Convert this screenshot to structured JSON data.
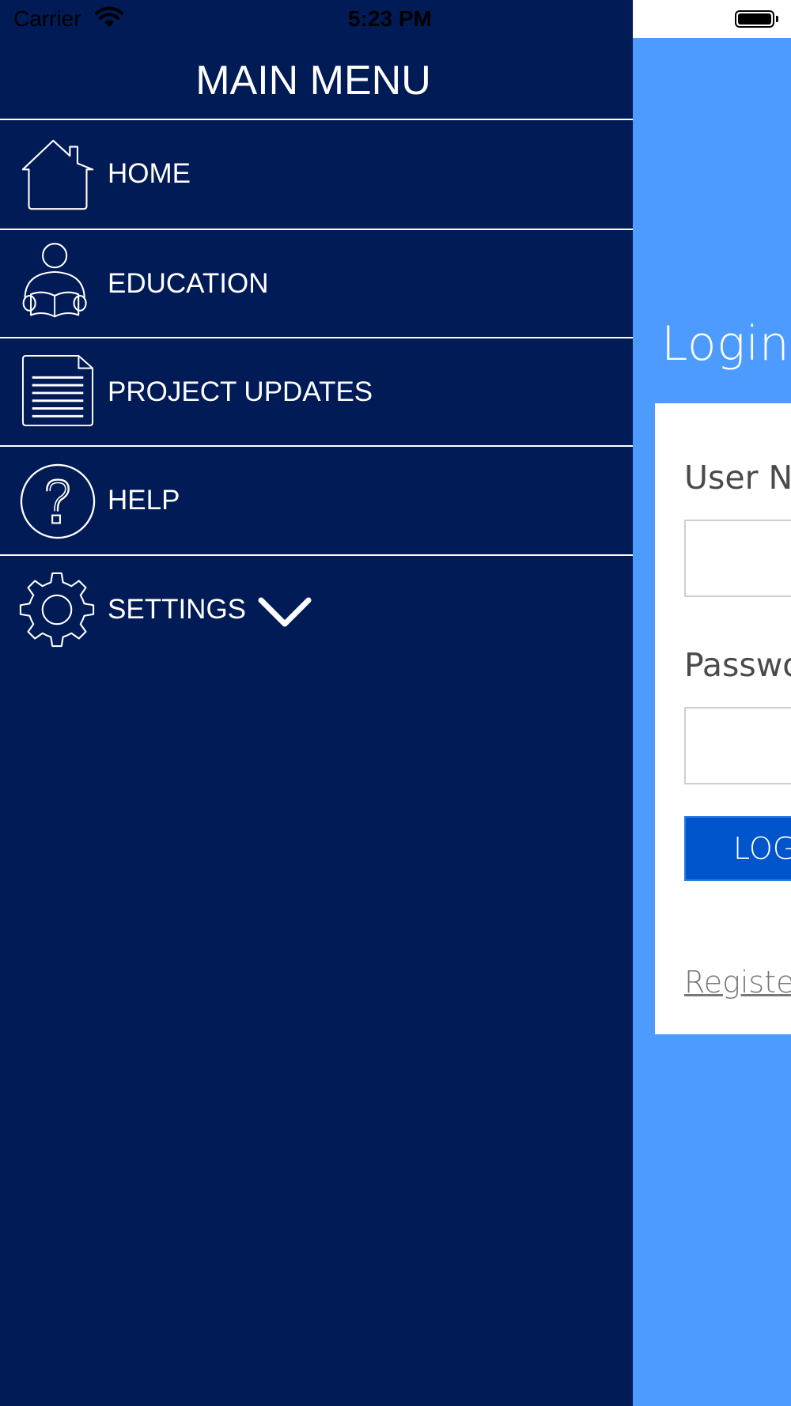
{
  "status_bar": {
    "carrier": "Carrier",
    "time": "5:23 PM"
  },
  "menu": {
    "title": "MAIN MENU",
    "items": [
      {
        "label": "HOME",
        "icon": "house-icon"
      },
      {
        "label": "EDUCATION",
        "icon": "person-reading-icon"
      },
      {
        "label": "PROJECT UPDATES",
        "icon": "document-icon"
      },
      {
        "label": "HELP",
        "icon": "help-question-icon"
      },
      {
        "label": "SETTINGS",
        "icon": "gear-icon",
        "expand_icon": "chevron-down-icon"
      }
    ]
  },
  "login": {
    "title": "Login",
    "username_label": "User Na",
    "password_label": "Passwo",
    "button_label": "LOG",
    "register_link": "Register"
  },
  "colors": {
    "drawer_background": "#001B55",
    "login_background": "#4D9BFF",
    "login_button": "#0055CC",
    "menu_text": "#FFFFFF"
  }
}
